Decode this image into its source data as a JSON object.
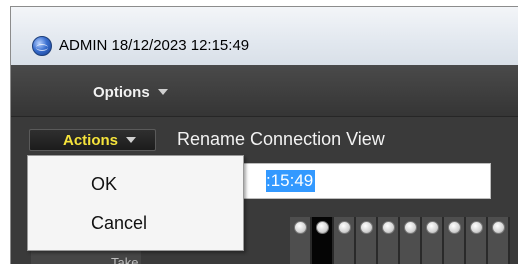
{
  "window": {
    "title": "ADMIN 18/12/2023 12:15:49",
    "app_icon": "globe-icon"
  },
  "toolbar": {
    "options_label": "Options"
  },
  "actions": {
    "label": "Actions"
  },
  "rename": {
    "title": "Rename Connection View",
    "input_visible_value": ":15:49"
  },
  "menu": {
    "items": [
      {
        "label": "OK"
      },
      {
        "label": "Cancel"
      }
    ]
  },
  "take": {
    "label": "Take"
  },
  "colors": {
    "actions_accent": "#f5e33b",
    "selection": "#3399ff",
    "dark_bg": "#3b3b3b"
  }
}
